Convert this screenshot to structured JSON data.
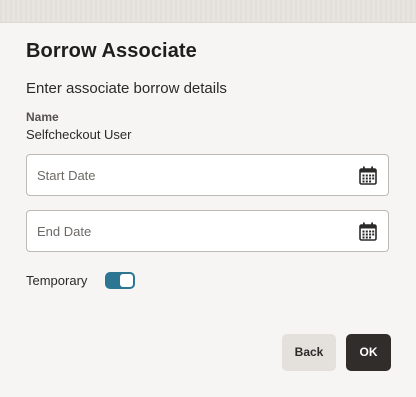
{
  "dialog": {
    "title": "Borrow Associate",
    "subtitle": "Enter associate borrow details",
    "name_label": "Name",
    "name_value": "Selfcheckout User",
    "start_date": {
      "value": "",
      "placeholder": "Start Date",
      "icon": "calendar-icon"
    },
    "end_date": {
      "value": "",
      "placeholder": "End Date",
      "icon": "calendar-icon"
    },
    "temporary": {
      "label": "Temporary",
      "checked": true,
      "color": "#2c7593"
    },
    "buttons": {
      "back_label": "Back",
      "ok_label": "OK"
    }
  }
}
